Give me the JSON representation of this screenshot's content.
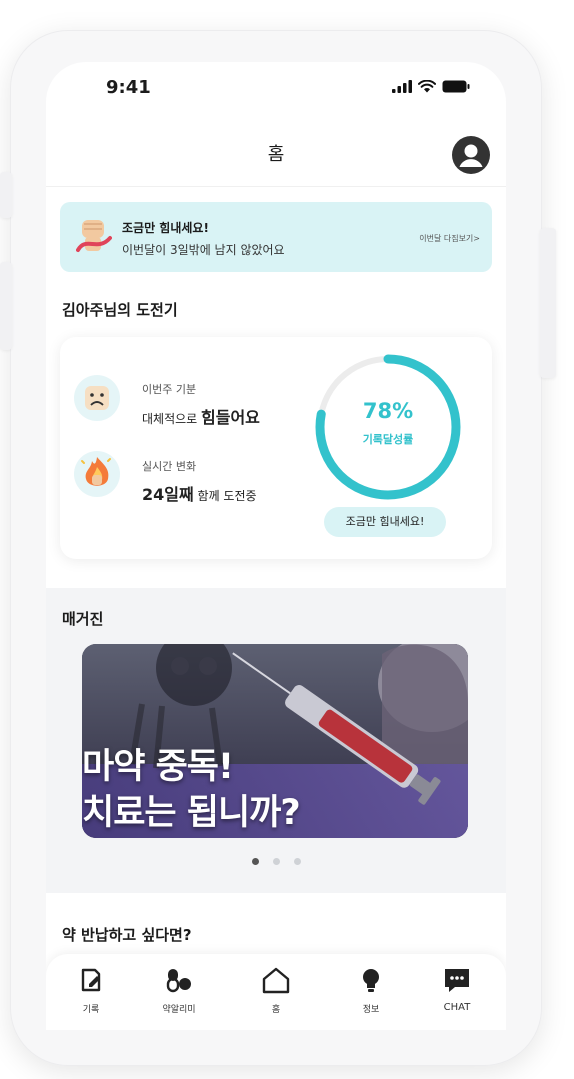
{
  "status_bar": {
    "time": "9:41"
  },
  "header": {
    "title": "홈"
  },
  "banner": {
    "title": "조금만 힘내세요!",
    "subtitle": "이번달이 3일밖에 남지 않았어요",
    "link": "이번달 다짐보기>"
  },
  "challenge": {
    "section_title": "김아주님의 도전기",
    "mood_label": "이번주 기분",
    "mood_prefix": "대체적으로 ",
    "mood_value": "힘들어요",
    "change_label": "실시간 변화",
    "days_value": "24일째",
    "days_suffix": " 함께 도전중",
    "progress_text": "78%",
    "progress_value": 0.78,
    "progress_label": "기록달성률",
    "cheer_button": "조금만 힘내세요!",
    "accent_color": "#33c2cc"
  },
  "magazine": {
    "section_title": "매거진",
    "headline_line1": "마약 중독!",
    "headline_line2": "치료는 됩니까?",
    "page_count": 3,
    "active_page": 1
  },
  "return_section": {
    "title": "약 반납하고 싶다면?"
  },
  "tabbar": {
    "items": [
      {
        "label": "기록",
        "icon": "record-icon"
      },
      {
        "label": "약알리미",
        "icon": "pill-icon"
      },
      {
        "label": "홈",
        "icon": "home-icon"
      },
      {
        "label": "정보",
        "icon": "lightbulb-icon"
      },
      {
        "label": "CHAT",
        "icon": "chat-icon"
      }
    ]
  }
}
